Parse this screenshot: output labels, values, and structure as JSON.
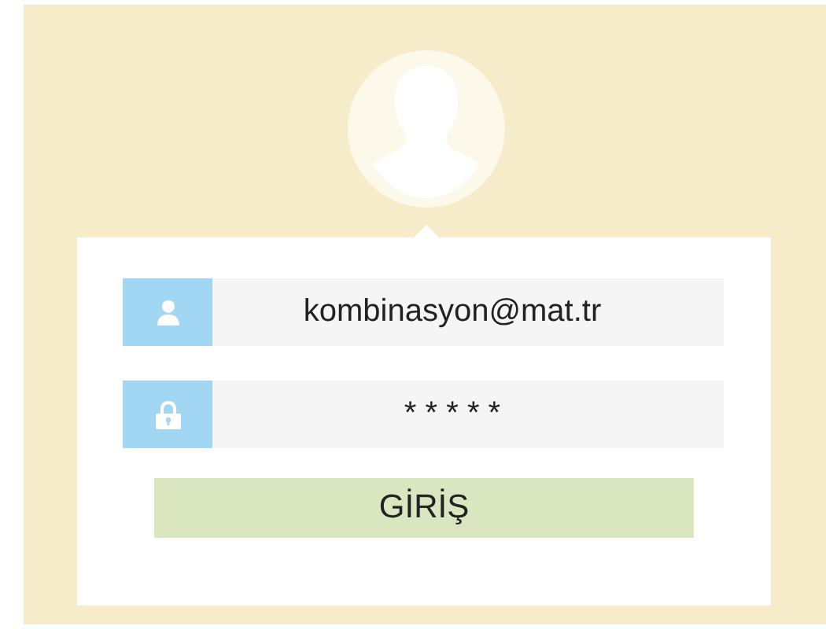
{
  "login_form": {
    "fields": [
      {
        "kind": "email",
        "value": "kombinasyon@mat.tr"
      },
      {
        "kind": "password",
        "value": "* * * * *"
      }
    ],
    "submit_button": "GİRİŞ"
  }
}
